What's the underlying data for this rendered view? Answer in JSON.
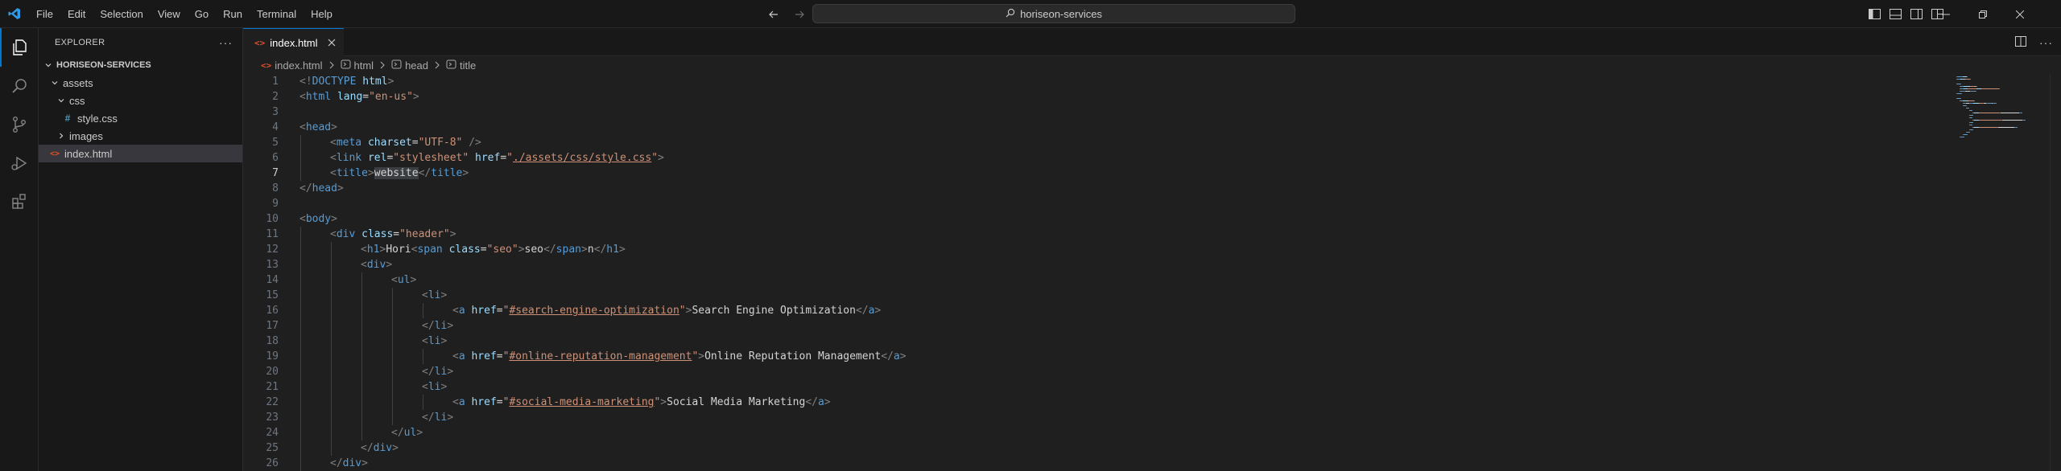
{
  "menu": [
    "File",
    "Edit",
    "Selection",
    "View",
    "Go",
    "Run",
    "Terminal",
    "Help"
  ],
  "search": {
    "text": "horiseon-services"
  },
  "sidebar": {
    "title": "EXPLORER",
    "root": "HORISEON-SERVICES",
    "items": [
      {
        "label": "assets",
        "kind": "folder-open",
        "depth": 1
      },
      {
        "label": "css",
        "kind": "folder-open",
        "depth": 2
      },
      {
        "label": "style.css",
        "kind": "css-file",
        "depth": 3
      },
      {
        "label": "images",
        "kind": "folder-closed",
        "depth": 2
      },
      {
        "label": "index.html",
        "kind": "html-file",
        "depth": 1,
        "selected": true
      }
    ]
  },
  "tab": {
    "label": "index.html"
  },
  "breadcrumb": {
    "file": "index.html",
    "html": "html",
    "head": "head",
    "title": "title"
  },
  "editor": {
    "current_line": 7,
    "lines": [
      {
        "n": "1",
        "indent": 0,
        "tokens": [
          [
            "t-tag",
            "<!"
          ],
          [
            "t-name",
            "DOCTYPE"
          ],
          [
            "t-text",
            " "
          ],
          [
            "t-attr",
            "html"
          ],
          [
            "t-tag",
            ">"
          ]
        ]
      },
      {
        "n": "2",
        "indent": 0,
        "tokens": [
          [
            "t-tag",
            "<"
          ],
          [
            "t-name",
            "html"
          ],
          [
            "t-text",
            " "
          ],
          [
            "t-attr",
            "lang"
          ],
          [
            "t-text",
            "="
          ],
          [
            "t-str",
            "\"en-us\""
          ],
          [
            "t-tag",
            ">"
          ]
        ]
      },
      {
        "n": "3",
        "indent": 0,
        "tokens": []
      },
      {
        "n": "4",
        "indent": 0,
        "tokens": [
          [
            "t-tag",
            "<"
          ],
          [
            "t-name",
            "head"
          ],
          [
            "t-tag",
            ">"
          ]
        ]
      },
      {
        "n": "5",
        "indent": 1,
        "tokens": [
          [
            "t-tag",
            "<"
          ],
          [
            "t-name",
            "meta"
          ],
          [
            "t-text",
            " "
          ],
          [
            "t-attr",
            "charset"
          ],
          [
            "t-text",
            "="
          ],
          [
            "t-str",
            "\"UTF-8\""
          ],
          [
            "t-text",
            " "
          ],
          [
            "t-tag",
            "/>"
          ]
        ]
      },
      {
        "n": "6",
        "indent": 1,
        "tokens": [
          [
            "t-tag",
            "<"
          ],
          [
            "t-name",
            "link"
          ],
          [
            "t-text",
            " "
          ],
          [
            "t-attr",
            "rel"
          ],
          [
            "t-text",
            "="
          ],
          [
            "t-str",
            "\"stylesheet\""
          ],
          [
            "t-text",
            " "
          ],
          [
            "t-attr",
            "href"
          ],
          [
            "t-text",
            "="
          ],
          [
            "t-str",
            "\""
          ],
          [
            "t-link",
            "./assets/css/style.css"
          ],
          [
            "t-str",
            "\""
          ],
          [
            "t-tag",
            ">"
          ]
        ]
      },
      {
        "n": "7",
        "indent": 1,
        "tokens": [
          [
            "t-tag",
            "<"
          ],
          [
            "t-name",
            "title"
          ],
          [
            "t-tag",
            ">"
          ],
          [
            "t-text hl",
            "website"
          ],
          [
            "t-tag",
            "</"
          ],
          [
            "t-name",
            "title"
          ],
          [
            "t-tag",
            ">"
          ]
        ]
      },
      {
        "n": "8",
        "indent": 0,
        "tokens": [
          [
            "t-tag",
            "</"
          ],
          [
            "t-name",
            "head"
          ],
          [
            "t-tag",
            ">"
          ]
        ]
      },
      {
        "n": "9",
        "indent": 0,
        "tokens": []
      },
      {
        "n": "10",
        "indent": 0,
        "tokens": [
          [
            "t-tag",
            "<"
          ],
          [
            "t-name",
            "body"
          ],
          [
            "t-tag",
            ">"
          ]
        ]
      },
      {
        "n": "11",
        "indent": 1,
        "tokens": [
          [
            "t-tag",
            "<"
          ],
          [
            "t-name",
            "div"
          ],
          [
            "t-text",
            " "
          ],
          [
            "t-attr",
            "class"
          ],
          [
            "t-text",
            "="
          ],
          [
            "t-str",
            "\"header\""
          ],
          [
            "t-tag",
            ">"
          ]
        ]
      },
      {
        "n": "12",
        "indent": 2,
        "tokens": [
          [
            "t-tag",
            "<"
          ],
          [
            "t-name",
            "h1"
          ],
          [
            "t-tag",
            ">"
          ],
          [
            "t-text",
            "Hori"
          ],
          [
            "t-tag",
            "<"
          ],
          [
            "t-name",
            "span"
          ],
          [
            "t-text",
            " "
          ],
          [
            "t-attr",
            "class"
          ],
          [
            "t-text",
            "="
          ],
          [
            "t-str",
            "\"seo\""
          ],
          [
            "t-tag",
            ">"
          ],
          [
            "t-text",
            "seo"
          ],
          [
            "t-tag",
            "</"
          ],
          [
            "t-name",
            "span"
          ],
          [
            "t-tag",
            ">"
          ],
          [
            "t-text",
            "n"
          ],
          [
            "t-tag",
            "</"
          ],
          [
            "t-name",
            "h1"
          ],
          [
            "t-tag",
            ">"
          ]
        ]
      },
      {
        "n": "13",
        "indent": 2,
        "tokens": [
          [
            "t-tag",
            "<"
          ],
          [
            "t-name",
            "div"
          ],
          [
            "t-tag",
            ">"
          ]
        ]
      },
      {
        "n": "14",
        "indent": 3,
        "tokens": [
          [
            "t-tag",
            "<"
          ],
          [
            "t-name",
            "ul"
          ],
          [
            "t-tag",
            ">"
          ]
        ]
      },
      {
        "n": "15",
        "indent": 4,
        "tokens": [
          [
            "t-tag",
            "<"
          ],
          [
            "t-name",
            "li"
          ],
          [
            "t-tag",
            ">"
          ]
        ]
      },
      {
        "n": "16",
        "indent": 5,
        "tokens": [
          [
            "t-tag",
            "<"
          ],
          [
            "t-name",
            "a"
          ],
          [
            "t-text",
            " "
          ],
          [
            "t-attr",
            "href"
          ],
          [
            "t-text",
            "="
          ],
          [
            "t-str",
            "\""
          ],
          [
            "t-link",
            "#search-engine-optimization"
          ],
          [
            "t-str",
            "\""
          ],
          [
            "t-tag",
            ">"
          ],
          [
            "t-text",
            "Search Engine Optimization"
          ],
          [
            "t-tag",
            "</"
          ],
          [
            "t-name",
            "a"
          ],
          [
            "t-tag",
            ">"
          ]
        ]
      },
      {
        "n": "17",
        "indent": 4,
        "tokens": [
          [
            "t-tag",
            "</"
          ],
          [
            "t-name",
            "li"
          ],
          [
            "t-tag",
            ">"
          ]
        ]
      },
      {
        "n": "18",
        "indent": 4,
        "tokens": [
          [
            "t-tag",
            "<"
          ],
          [
            "t-name",
            "li"
          ],
          [
            "t-tag",
            ">"
          ]
        ]
      },
      {
        "n": "19",
        "indent": 5,
        "tokens": [
          [
            "t-tag",
            "<"
          ],
          [
            "t-name",
            "a"
          ],
          [
            "t-text",
            " "
          ],
          [
            "t-attr",
            "href"
          ],
          [
            "t-text",
            "="
          ],
          [
            "t-str",
            "\""
          ],
          [
            "t-link",
            "#online-reputation-management"
          ],
          [
            "t-str",
            "\""
          ],
          [
            "t-tag",
            ">"
          ],
          [
            "t-text",
            "Online Reputation Management"
          ],
          [
            "t-tag",
            "</"
          ],
          [
            "t-name",
            "a"
          ],
          [
            "t-tag",
            ">"
          ]
        ]
      },
      {
        "n": "20",
        "indent": 4,
        "tokens": [
          [
            "t-tag",
            "</"
          ],
          [
            "t-name",
            "li"
          ],
          [
            "t-tag",
            ">"
          ]
        ]
      },
      {
        "n": "21",
        "indent": 4,
        "tokens": [
          [
            "t-tag",
            "<"
          ],
          [
            "t-name",
            "li"
          ],
          [
            "t-tag",
            ">"
          ]
        ]
      },
      {
        "n": "22",
        "indent": 5,
        "tokens": [
          [
            "t-tag",
            "<"
          ],
          [
            "t-name",
            "a"
          ],
          [
            "t-text",
            " "
          ],
          [
            "t-attr",
            "href"
          ],
          [
            "t-text",
            "="
          ],
          [
            "t-str",
            "\""
          ],
          [
            "t-link",
            "#social-media-marketing"
          ],
          [
            "t-str",
            "\""
          ],
          [
            "t-tag",
            ">"
          ],
          [
            "t-text",
            "Social Media Marketing"
          ],
          [
            "t-tag",
            "</"
          ],
          [
            "t-name",
            "a"
          ],
          [
            "t-tag",
            ">"
          ]
        ]
      },
      {
        "n": "23",
        "indent": 4,
        "tokens": [
          [
            "t-tag",
            "</"
          ],
          [
            "t-name",
            "li"
          ],
          [
            "t-tag",
            ">"
          ]
        ]
      },
      {
        "n": "24",
        "indent": 3,
        "tokens": [
          [
            "t-tag",
            "</"
          ],
          [
            "t-name",
            "ul"
          ],
          [
            "t-tag",
            ">"
          ]
        ]
      },
      {
        "n": "25",
        "indent": 2,
        "tokens": [
          [
            "t-tag",
            "</"
          ],
          [
            "t-name",
            "div"
          ],
          [
            "t-tag",
            ">"
          ]
        ]
      },
      {
        "n": "26",
        "indent": 1,
        "tokens": [
          [
            "t-tag",
            "</"
          ],
          [
            "t-name",
            "div"
          ],
          [
            "t-tag",
            ">"
          ]
        ]
      }
    ]
  },
  "colors": {
    "accent": "#0078d4",
    "html_icon": "#e44d26",
    "css_icon": "#519aba"
  }
}
